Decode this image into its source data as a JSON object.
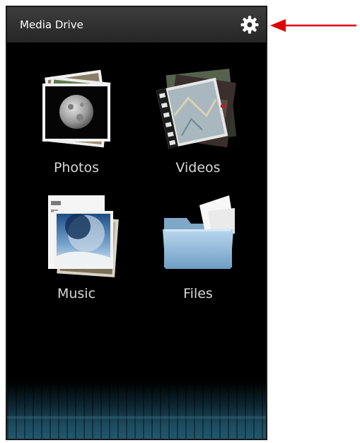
{
  "app": {
    "title": "Media Drive"
  },
  "toolbar": {
    "settings_icon": "gear-icon"
  },
  "grid": [
    {
      "label": "Photos",
      "icon": "photos-stack-icon"
    },
    {
      "label": "Videos",
      "icon": "videos-stack-icon"
    },
    {
      "label": "Music",
      "icon": "music-stack-icon"
    },
    {
      "label": "Files",
      "icon": "folder-icon"
    }
  ],
  "annotation": {
    "icon": "arrow-left-icon",
    "color": "#e00000"
  },
  "colors": {
    "background": "#000000",
    "action_bar": "#2f2f2f",
    "text": "#ffffff"
  }
}
